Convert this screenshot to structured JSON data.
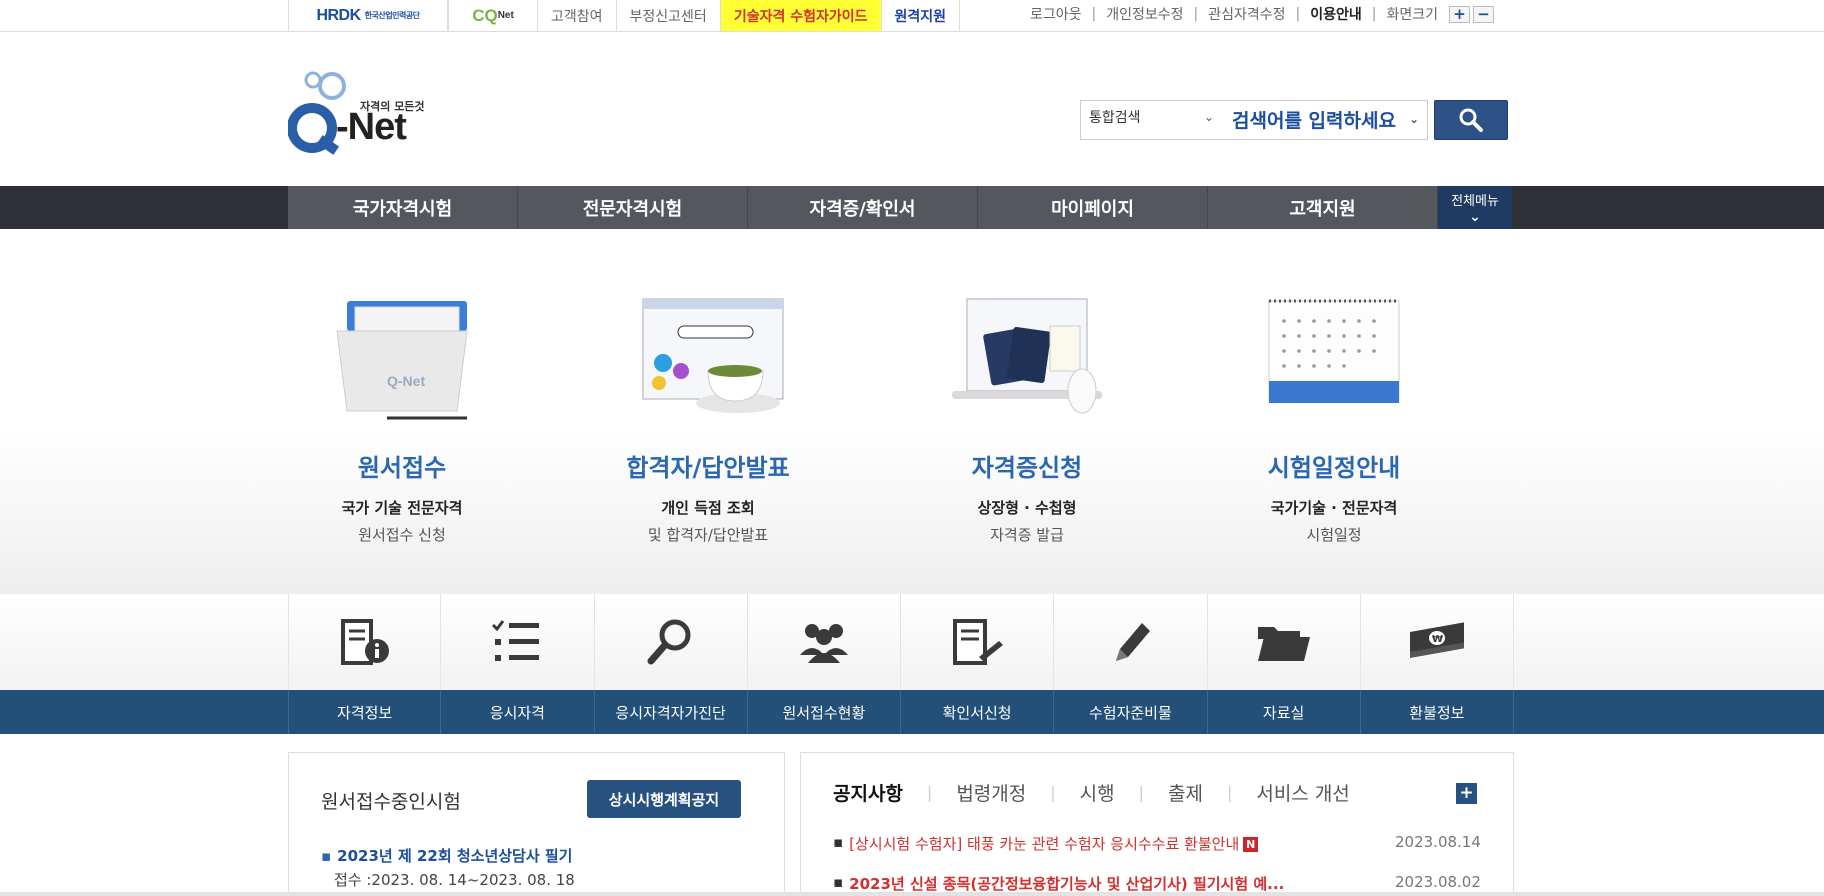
{
  "topbar": {
    "hrdk_logo": "HRDK",
    "hrdk_sub": "한국산업인력공단",
    "cq_logo": "CQ",
    "cq_sub": "Net",
    "links": [
      "고객참여",
      "부정신고센터",
      "기술자격 수험자가이드",
      "원격지원"
    ],
    "right_links": [
      "로그아웃",
      "개인정보수정",
      "관심자격수정",
      "이용안내",
      "화면크기"
    ],
    "zoom_in": "+",
    "zoom_out": "−"
  },
  "header": {
    "logo_tagline": "자격의 모든것",
    "logo_text": "-Net",
    "search_scope": "통합검색",
    "search_placeholder": "검색어를 입력하세요"
  },
  "mainnav": {
    "items": [
      "국가자격시험",
      "전문자격시험",
      "자격증/확인서",
      "마이페이지",
      "고객지원"
    ],
    "all_menu": "전체메뉴"
  },
  "hero": [
    {
      "title": "원서접수",
      "sub1": "국가 기술 전문자격",
      "sub2": "원서접수 신청"
    },
    {
      "title": "합격자/답안발표",
      "sub1": "개인 득점 조회",
      "sub2": "및 합격자/답안발표"
    },
    {
      "title": "자격증신청",
      "sub1": "상장형 · 수첩형",
      "sub2": "자격증 발급"
    },
    {
      "title": "시험일정안내",
      "sub1": "국가기술 · 전문자격",
      "sub2": "시험일정"
    }
  ],
  "quick": [
    {
      "label": "자격정보",
      "icon": "document-info-icon"
    },
    {
      "label": "응시자격",
      "icon": "checklist-icon"
    },
    {
      "label": "응시자격자가진단",
      "icon": "magnifier-icon"
    },
    {
      "label": "원서접수현황",
      "icon": "people-icon"
    },
    {
      "label": "확인서신청",
      "icon": "document-edit-icon"
    },
    {
      "label": "수험자준비물",
      "icon": "pencil-icon"
    },
    {
      "label": "자료실",
      "icon": "folder-icon"
    },
    {
      "label": "환불정보",
      "icon": "money-icon"
    }
  ],
  "panel_left": {
    "title": "원서접수중인시험",
    "button": "상시시행계획공지",
    "exam": "2023년 제 22회 청소년상담사 필기",
    "period": "접수 :2023. 08. 14~2023. 08. 18"
  },
  "panel_right": {
    "tabs": [
      "공지사항",
      "법령개정",
      "시행",
      "출제",
      "서비스 개선"
    ],
    "plus": "+",
    "notices": [
      {
        "text": "[상시시험 수험자] 태풍 카눈 관련 수험자 응시수수료 환불안내",
        "badge": "N",
        "date": "2023.08.14"
      },
      {
        "text": "2023년 신설 종목(공간정보융합기능사 및 산업기사) 필기시험 예...",
        "date": "2023.08.02"
      }
    ]
  },
  "colors": {
    "brand_blue": "#2a67b1",
    "nav_dark": "#2f3136",
    "quick_bar": "#235079",
    "alert_red": "#d32f2f"
  }
}
